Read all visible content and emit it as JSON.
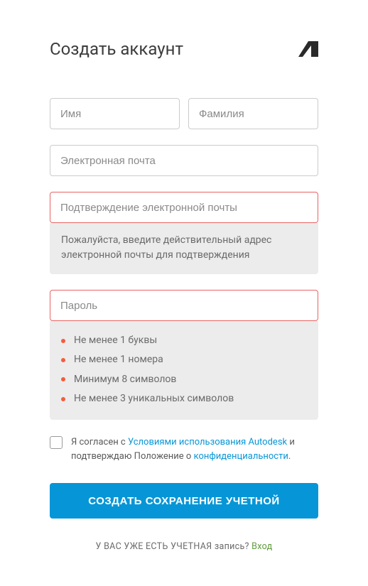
{
  "header": {
    "title": "Создать аккаунт"
  },
  "fields": {
    "first_name": {
      "placeholder": "Имя",
      "value": ""
    },
    "last_name": {
      "placeholder": "Фамилия",
      "value": ""
    },
    "email": {
      "placeholder": "Электронная почта",
      "value": ""
    },
    "email_confirm": {
      "placeholder": "Подтверждение электронной почты",
      "value": "",
      "error": true,
      "hint": "Пожалуйста, введите действительный адрес электронной почты для подтверждения"
    },
    "password": {
      "placeholder": "Пароль",
      "value": "",
      "error": true,
      "rules": [
        "Не менее 1 буквы",
        "Не менее 1 номера",
        "Минимум 8 символов",
        "Не менее 3 уникальных символов"
      ]
    }
  },
  "agree": {
    "prefix": "Я согласен с ",
    "terms_link": "Условиями использования Autodesk",
    "middle": " и подтверждаю Положение о ",
    "privacy_link": "конфиденциальности",
    "suffix": "."
  },
  "submit_label": "Создать сохранение учетной",
  "footer": {
    "text": "У ВАС УЖЕ ЕСТЬ УЧЕТНАЯ запись? ",
    "link": "Вход"
  },
  "colors": {
    "primary": "#0696d7",
    "error_border": "#e96464",
    "rule_dot": "#f65c3c",
    "signin_link": "#5f9b3c"
  }
}
